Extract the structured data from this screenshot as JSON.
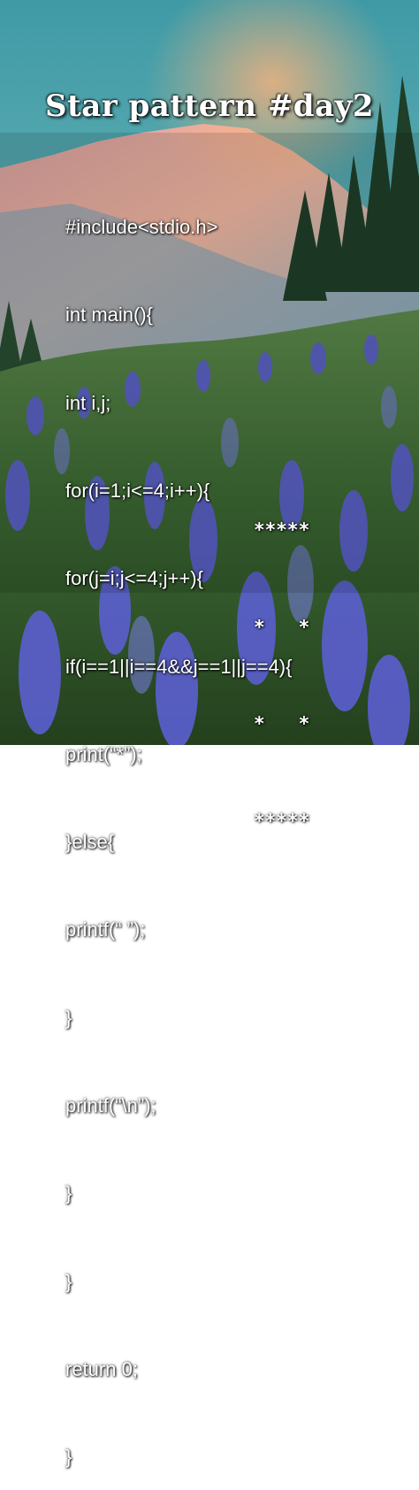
{
  "title": "Star pattern #day2",
  "code_lines": [
    "#include<stdio.h>",
    "int main(){",
    "int i,j;",
    "for(i=1;i<=4;i++){",
    "for(j=i;j<=4;j++){",
    "if(i==1||i==4&&j==1||j==4){",
    "print(“*”);",
    "}else{",
    "printf(“ ”);",
    "}",
    "printf(“\\n”);",
    "}",
    "}",
    "return 0;",
    "}"
  ],
  "output_rows": [
    "*****",
    "*   *",
    "*   *",
    "*****"
  ]
}
